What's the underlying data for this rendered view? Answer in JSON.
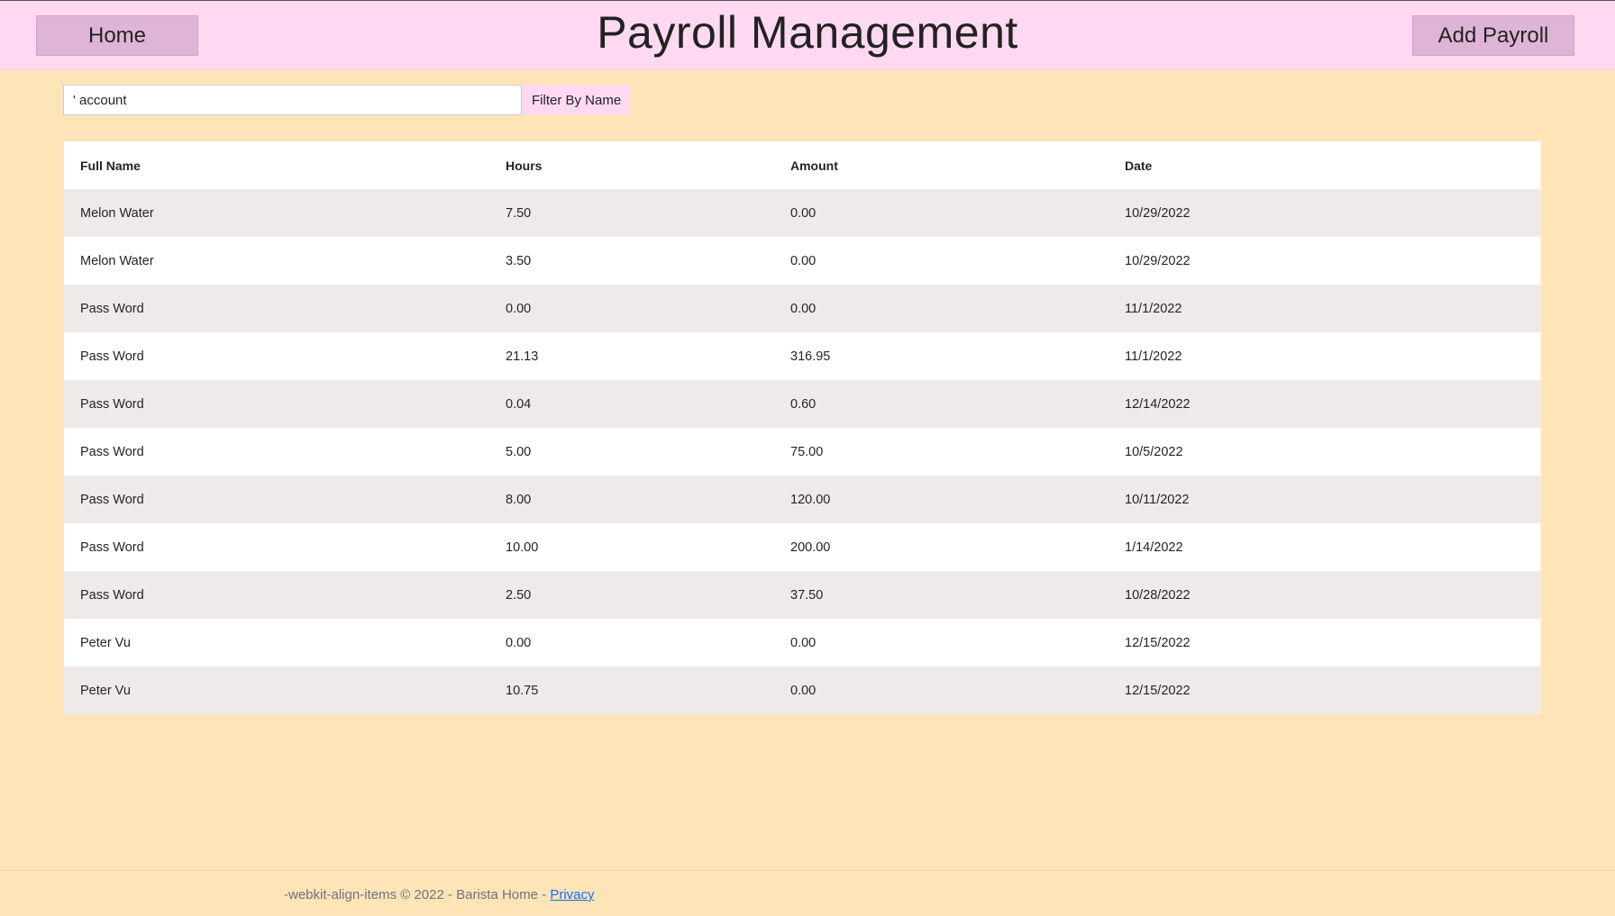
{
  "header": {
    "title": "Payroll Management",
    "home_label": "Home",
    "add_label": "Add Payroll"
  },
  "filter": {
    "value": "' account",
    "button_label": "Filter By Name"
  },
  "table": {
    "columns": [
      "Full Name",
      "Hours",
      "Amount",
      "Date"
    ],
    "rows": [
      [
        "Melon Water",
        "7.50",
        "0.00",
        "10/29/2022"
      ],
      [
        "Melon Water",
        "3.50",
        "0.00",
        "10/29/2022"
      ],
      [
        "Pass Word",
        "0.00",
        "0.00",
        "11/1/2022"
      ],
      [
        "Pass Word",
        "21.13",
        "316.95",
        "11/1/2022"
      ],
      [
        "Pass Word",
        "0.04",
        "0.60",
        "12/14/2022"
      ],
      [
        "Pass Word",
        "5.00",
        "75.00",
        "10/5/2022"
      ],
      [
        "Pass Word",
        "8.00",
        "120.00",
        "10/11/2022"
      ],
      [
        "Pass Word",
        "10.00",
        "200.00",
        "1/14/2022"
      ],
      [
        "Pass Word",
        "2.50",
        "37.50",
        "10/28/2022"
      ],
      [
        "Peter Vu",
        "0.00",
        "0.00",
        "12/15/2022"
      ],
      [
        "Peter Vu",
        "10.75",
        "0.00",
        "12/15/2022"
      ]
    ],
    "row_action_icon": "edit-icon"
  },
  "footer": {
    "text": "-webkit-align-items © 2022 - Barista Home - ",
    "privacy_label": "Privacy"
  },
  "colors": {
    "page_bg": "#ffe4b8",
    "topbar_bg": "#ffd9f2",
    "nav_button_bg": "#deb5d6",
    "row_alt_bg": "#efeaea",
    "link": "#0d6efd"
  }
}
